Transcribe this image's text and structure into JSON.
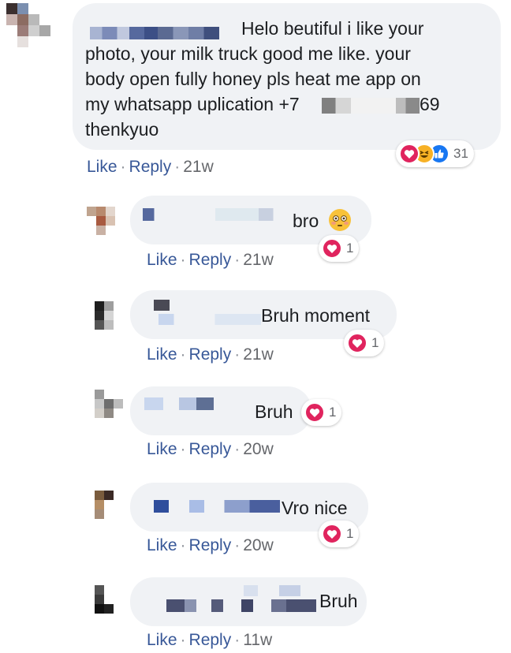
{
  "colors": {
    "bubble": "#f0f2f5",
    "link": "#385898",
    "meta": "#65676b",
    "love": "#e0245e",
    "like": "#1877f2",
    "haha": "#f7b125"
  },
  "main_comment": {
    "text_lines": [
      "Helo beutiful i like your",
      "photo, your milk truck good me like. your",
      "body open fully honey pls heat me app on",
      "my whatsapp uplication +7",
      "69",
      "thenkyuo"
    ],
    "reaction_icons": [
      "love-icon",
      "haha-icon",
      "like-icon"
    ],
    "reaction_count": "31",
    "actions": {
      "like": "Like",
      "reply": "Reply",
      "time": "21w"
    }
  },
  "replies": [
    {
      "text": "bro",
      "emoji": "flushed-emoji",
      "reaction_icon": "love-icon",
      "reaction_count": "1",
      "actions": {
        "like": "Like",
        "reply": "Reply",
        "time": "21w"
      }
    },
    {
      "text": "Bruh moment",
      "reaction_icon": "love-icon",
      "reaction_count": "1",
      "actions": {
        "like": "Like",
        "reply": "Reply",
        "time": "21w"
      }
    },
    {
      "text": "Bruh",
      "reaction_icon": "love-icon",
      "reaction_count": "1",
      "actions": {
        "like": "Like",
        "reply": "Reply",
        "time": "20w"
      }
    },
    {
      "text": "Vro nice",
      "reaction_icon": "love-icon",
      "reaction_count": "1",
      "actions": {
        "like": "Like",
        "reply": "Reply",
        "time": "20w"
      }
    },
    {
      "text": "Bruh",
      "actions": {
        "like": "Like",
        "reply": "Reply",
        "time": "11w"
      }
    }
  ],
  "separator": "·"
}
